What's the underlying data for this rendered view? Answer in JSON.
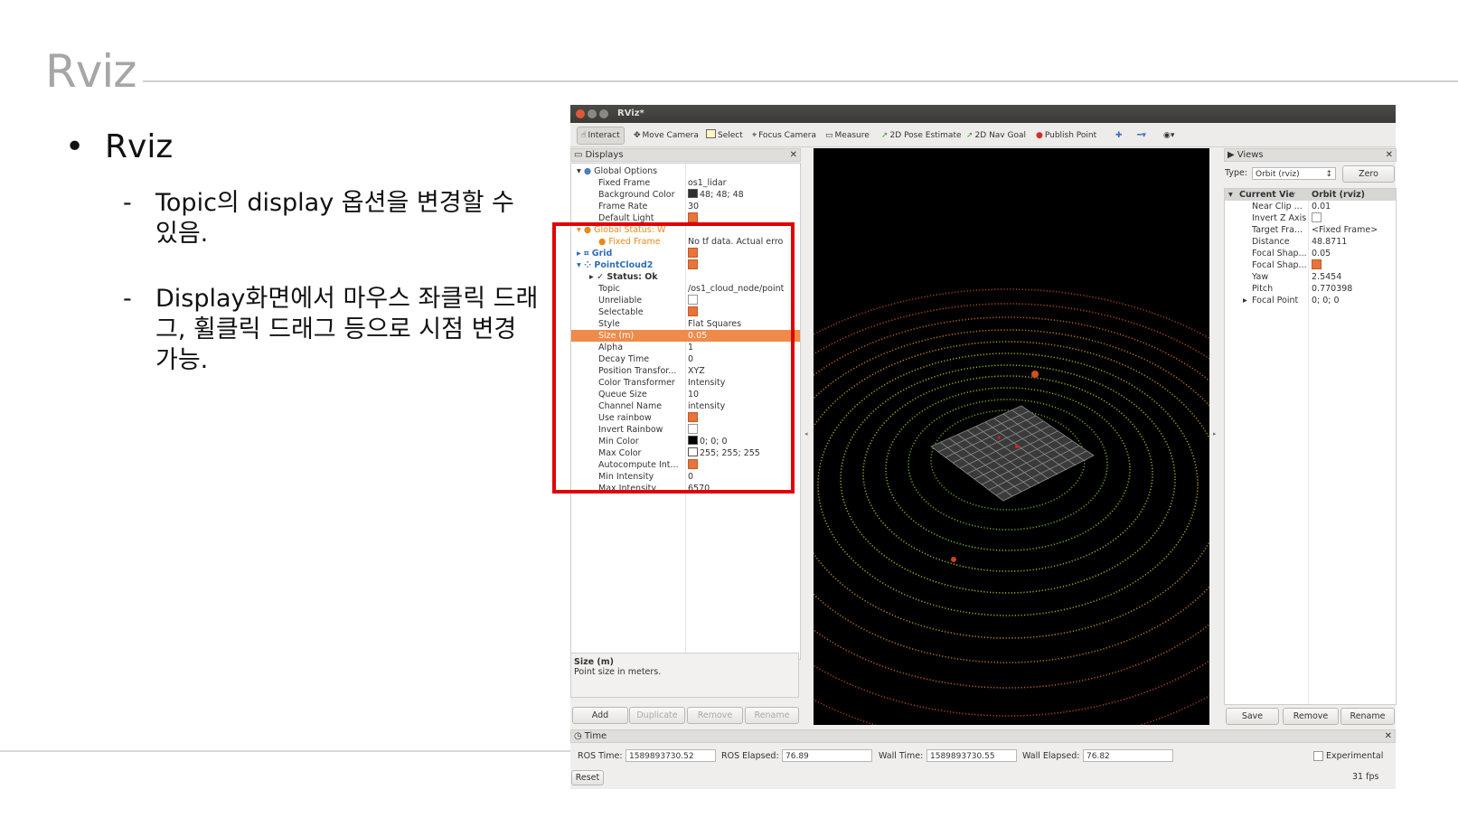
{
  "slide": {
    "title": "Rviz",
    "bullet": "Rviz",
    "subs": [
      "Topic의 display 옵션을 변경할 수 있음.",
      "Display화면에서 마우스 좌클릭 드래그, 휠클릭 드래그 등으로 시점 변경 가능."
    ]
  },
  "window": {
    "title": "RViz*"
  },
  "toolbar": {
    "interact": "Interact",
    "move_camera": "Move Camera",
    "select": "Select",
    "focus_camera": "Focus Camera",
    "measure": "Measure",
    "pose_estimate": "2D Pose Estimate",
    "nav_goal": "2D Nav Goal",
    "publish_point": "Publish Point"
  },
  "displays": {
    "header": "Displays",
    "rows": [
      {
        "k": "Global Options",
        "v": ""
      },
      {
        "k": "Fixed Frame",
        "v": "os1_lidar"
      },
      {
        "k": "Background Color",
        "v": "48; 48; 48"
      },
      {
        "k": "Frame Rate",
        "v": "30"
      },
      {
        "k": "Default Light",
        "v": ""
      },
      {
        "k": "Global Status: W...",
        "v": ""
      },
      {
        "k": "Fixed Frame",
        "v": "No tf data.  Actual erro"
      },
      {
        "k": "Grid",
        "v": ""
      },
      {
        "k": "PointCloud2",
        "v": ""
      },
      {
        "k": "Status: Ok",
        "v": ""
      },
      {
        "k": "Topic",
        "v": "/os1_cloud_node/point"
      },
      {
        "k": "Unreliable",
        "v": ""
      },
      {
        "k": "Selectable",
        "v": ""
      },
      {
        "k": "Style",
        "v": "Flat Squares"
      },
      {
        "k": "Size (m)",
        "v": "0.05"
      },
      {
        "k": "Alpha",
        "v": "1"
      },
      {
        "k": "Decay Time",
        "v": "0"
      },
      {
        "k": "Position Transfor...",
        "v": "XYZ"
      },
      {
        "k": "Color Transformer",
        "v": "Intensity"
      },
      {
        "k": "Queue Size",
        "v": "10"
      },
      {
        "k": "Channel Name",
        "v": "intensity"
      },
      {
        "k": "Use rainbow",
        "v": ""
      },
      {
        "k": "Invert Rainbow",
        "v": ""
      },
      {
        "k": "Min Color",
        "v": "0; 0; 0"
      },
      {
        "k": "Max Color",
        "v": "255; 255; 255"
      },
      {
        "k": "Autocompute Int...",
        "v": ""
      },
      {
        "k": "Min Intensity",
        "v": "0"
      },
      {
        "k": "Max Intensity",
        "v": "6570"
      }
    ],
    "desc_title": "Size (m)",
    "desc_text": "Point size in meters.",
    "buttons": [
      "Add",
      "Duplicate",
      "Remove",
      "Rename"
    ]
  },
  "views": {
    "header": "Views",
    "type_label": "Type:",
    "type_value": "Orbit (rviz)",
    "zero": "Zero",
    "current_view": "Current View",
    "current_view_type": "Orbit (rviz)",
    "rows": [
      {
        "k": "Near Clip ...",
        "v": "0.01"
      },
      {
        "k": "Invert Z Axis",
        "v": ""
      },
      {
        "k": "Target Fra...",
        "v": "<Fixed Frame>"
      },
      {
        "k": "Distance",
        "v": "48.8711"
      },
      {
        "k": "Focal Shap...",
        "v": "0.05"
      },
      {
        "k": "Focal Shap...",
        "v": ""
      },
      {
        "k": "Yaw",
        "v": "2.5454"
      },
      {
        "k": "Pitch",
        "v": "0.770398"
      },
      {
        "k": "Focal Point",
        "v": "0; 0; 0"
      }
    ],
    "buttons": [
      "Save",
      "Remove",
      "Rename"
    ]
  },
  "time": {
    "header": "Time",
    "ros_time_label": "ROS Time:",
    "ros_time": "1589893730.52",
    "ros_elapsed_label": "ROS Elapsed:",
    "ros_elapsed": "76.89",
    "wall_time_label": "Wall Time:",
    "wall_time": "1589893730.55",
    "wall_elapsed_label": "Wall Elapsed:",
    "wall_elapsed": "76.82",
    "experimental": "Experimental",
    "reset": "Reset",
    "fps": "31 fps"
  },
  "colors": {
    "highlight_box": "#e00000",
    "selected_row": "#ee8a4a",
    "viewport_bg": "#000000"
  }
}
